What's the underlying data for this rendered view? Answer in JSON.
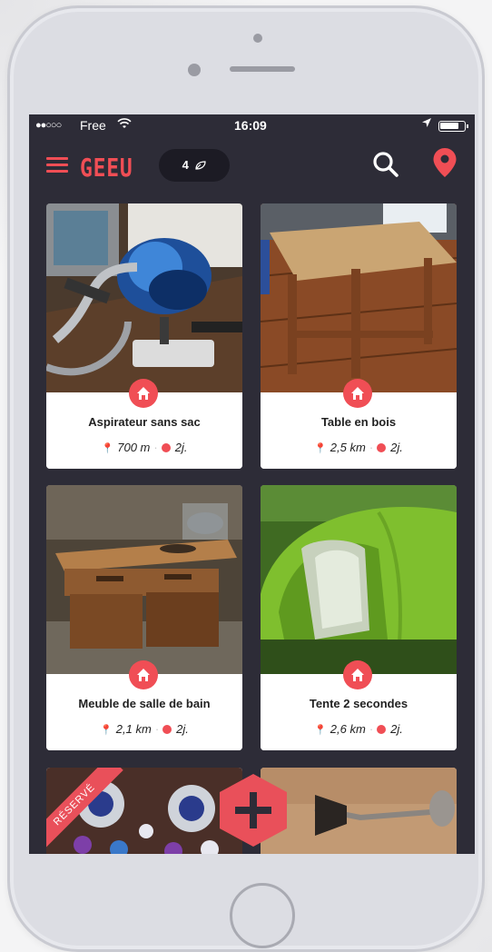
{
  "status_bar": {
    "signal": "●●○○○",
    "carrier": "Free",
    "time": "16:09"
  },
  "nav": {
    "logo": "GEEU",
    "counter": "4",
    "counter_icon": "leaf-icon"
  },
  "cards": [
    {
      "title": "Aspirateur sans sac",
      "distance": "700 m",
      "age": "2j.",
      "badge": "home-icon"
    },
    {
      "title": "Table en bois",
      "distance": "2,5 km",
      "age": "2j.",
      "badge": "home-icon"
    },
    {
      "title": "Meuble de salle de bain",
      "distance": "2,1 km",
      "age": "2j.",
      "badge": "home-icon"
    },
    {
      "title": "Tente 2 secondes",
      "distance": "2,6 km",
      "age": "2j.",
      "badge": "home-icon"
    }
  ],
  "partial_cards": [
    {
      "ribbon": "RÉSERVÉ"
    }
  ],
  "colors": {
    "accent": "#f04e55",
    "screen_bg": "#2d2c37",
    "card_bg": "#ffffff"
  }
}
